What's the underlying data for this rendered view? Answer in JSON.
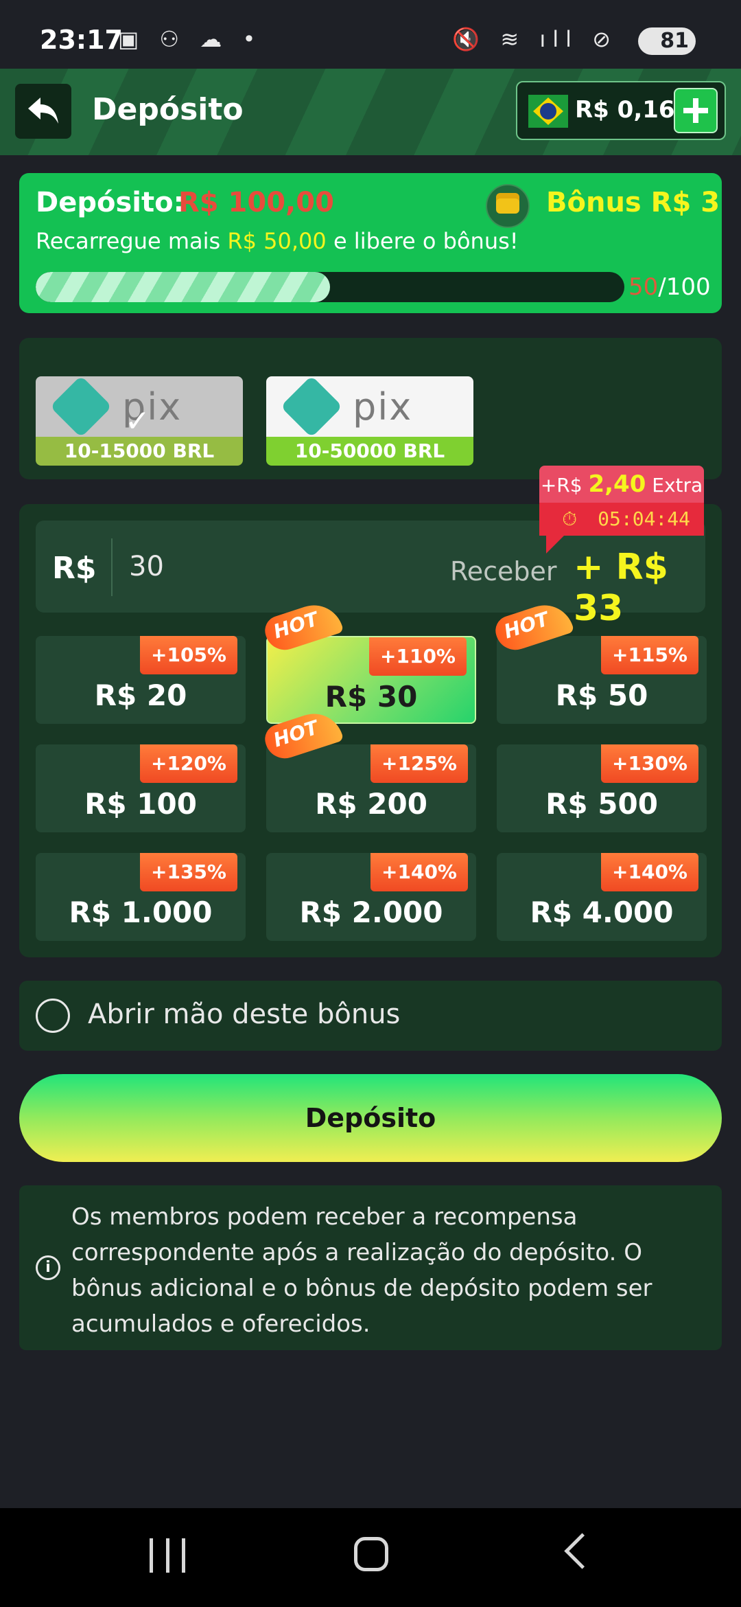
{
  "status_bar": {
    "time": "23:17",
    "battery": "81"
  },
  "header": {
    "title": "Depósito",
    "balance": "R$ 0,16"
  },
  "bonus_card": {
    "deposit_label": "Depósito:",
    "deposit_value": "R$ 100,00",
    "bonus_label": "Bônus R$ 3",
    "sub_prefix": "Recarregue mais ",
    "sub_amount": "R$ 50,00",
    "sub_suffix": " e libere o bônus!",
    "progress_current": "50",
    "progress_total": "/100",
    "progress_fraction": 0.5
  },
  "payment_methods": [
    {
      "logo_text": "pix",
      "range": "10-15000 BRL",
      "selected": true
    },
    {
      "logo_text": "pix",
      "range": "10-50000 BRL",
      "selected": false
    }
  ],
  "amount_input": {
    "currency": "R$",
    "value": "30",
    "receive_label": "Receber",
    "receive_value": "+ R$ 33"
  },
  "extra_badge": {
    "prefix": "+R$ ",
    "amount": "2,40",
    "suffix": " Extra",
    "timer": "05:04:44"
  },
  "amount_options": [
    {
      "value": "R$ 20",
      "bonus": "+105%",
      "hot": false,
      "selected": false
    },
    {
      "value": "R$ 30",
      "bonus": "+110%",
      "hot": true,
      "selected": true
    },
    {
      "value": "R$ 50",
      "bonus": "+115%",
      "hot": true,
      "selected": false
    },
    {
      "value": "R$ 100",
      "bonus": "+120%",
      "hot": false,
      "selected": false
    },
    {
      "value": "R$ 200",
      "bonus": "+125%",
      "hot": true,
      "selected": false
    },
    {
      "value": "R$ 500",
      "bonus": "+130%",
      "hot": false,
      "selected": false
    },
    {
      "value": "R$ 1.000",
      "bonus": "+135%",
      "hot": false,
      "selected": false
    },
    {
      "value": "R$ 2.000",
      "bonus": "+140%",
      "hot": false,
      "selected": false
    },
    {
      "value": "R$ 4.000",
      "bonus": "+140%",
      "hot": false,
      "selected": false
    }
  ],
  "hot_label": "HOT",
  "optout": {
    "label": "Abrir mão deste bônus",
    "checked": false
  },
  "deposit_button": {
    "label": "Depósito"
  },
  "info": {
    "text": "Os membros podem receber a recompensa correspondente após a realização do depósito. O bônus adicional e o bônus de depósito podem ser acumulados e oferecidos."
  },
  "colors": {
    "accent_green": "#14c153",
    "highlight_yellow": "#f5f51e",
    "alert_red": "#e74c3c",
    "panel": "#183724"
  }
}
